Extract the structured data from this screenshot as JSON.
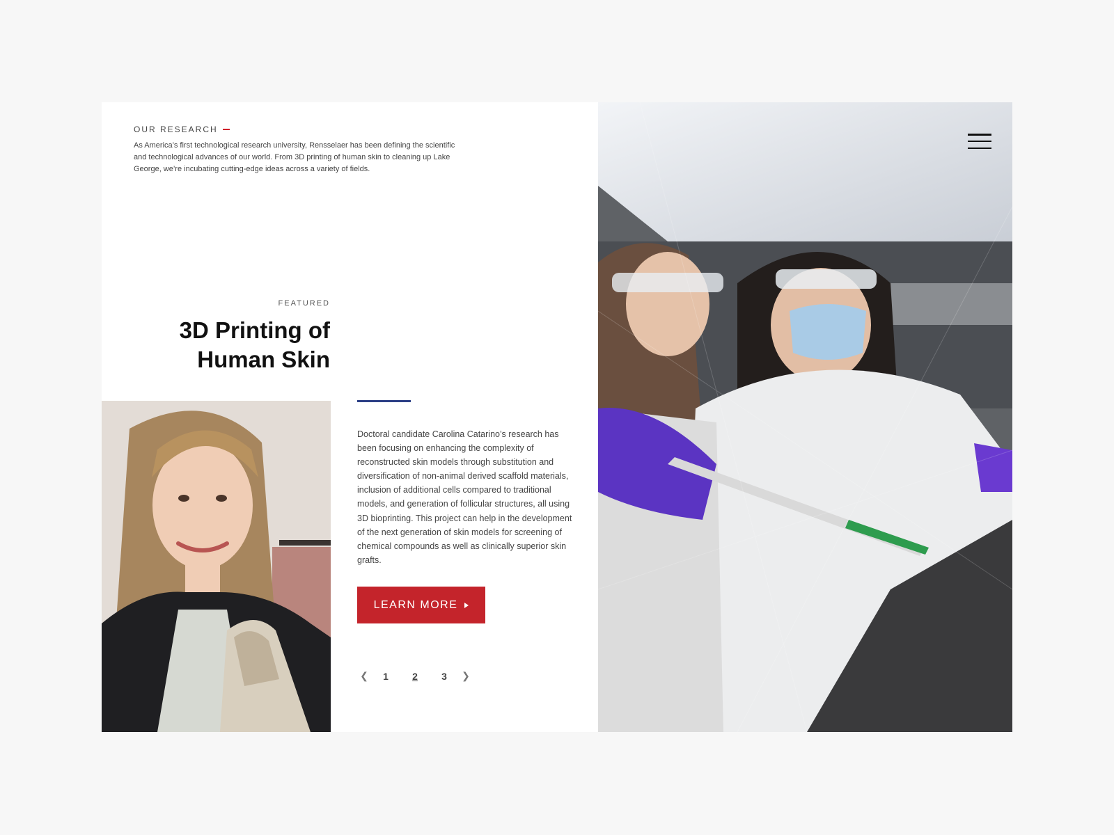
{
  "intro": {
    "eyebrow": "OUR RESEARCH",
    "description": "As America’s first technological research university, Rensselaer has been defining the scientific and technological advances of our world. From 3D printing of human skin to cleaning up Lake George, we’re incubating cutting-edge ideas across a variety of fields."
  },
  "featured": {
    "label": "FEATURED",
    "title_line1": "3D Printing of",
    "title_line2": "Human Skin",
    "body": "Doctoral candidate Carolina Catarino’s research has been focusing on enhancing the complexity of reconstructed skin models through substitution and diversification of non-animal derived scaffold materials, inclusion of additional cells compared to traditional models, and generation of follicular structures, all using 3D bioprinting. This project can help in the development of the next generation of skin models for screening of chemical compounds as well as clinically superior skin grafts.",
    "cta_label": "LEARN MORE"
  },
  "pagination": {
    "pages": [
      "1",
      "2",
      "3"
    ],
    "active_page": "2"
  },
  "colors": {
    "accent_red": "#c4242b",
    "accent_blue": "#2b3f86",
    "page_background": "#f7f7f7"
  },
  "icons": {
    "menu": "hamburger-menu-icon",
    "prev": "chevron-left-icon",
    "next": "chevron-right-icon",
    "cta": "caret-right-icon"
  }
}
